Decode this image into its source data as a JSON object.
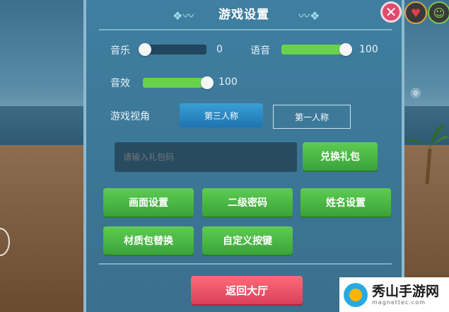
{
  "title": "游戏设置",
  "music": {
    "label": "音乐",
    "value": "0",
    "level": 0
  },
  "voice": {
    "label": "语音",
    "value": "100",
    "level": 1
  },
  "sfx": {
    "label": "音效",
    "value": "100",
    "level": 1
  },
  "camera": {
    "label": "游戏视角",
    "options": [
      "第三人称",
      "第一人称"
    ],
    "selected": "第三人称"
  },
  "gift": {
    "placeholder": "请输入礼包码",
    "button": "兑换礼包"
  },
  "buttons": {
    "graphics": "画面设置",
    "password": "二级密码",
    "name": "姓名设置",
    "texture": "材质包替换",
    "keys": "自定义按键",
    "back": "返回大厅"
  },
  "watermark": {
    "title": "秀山手游网",
    "sub": "magnettec.com"
  },
  "colors": {
    "accent_green": "#5dcc52",
    "accent_red": "#e04a6c",
    "panel": "#3c7797"
  }
}
